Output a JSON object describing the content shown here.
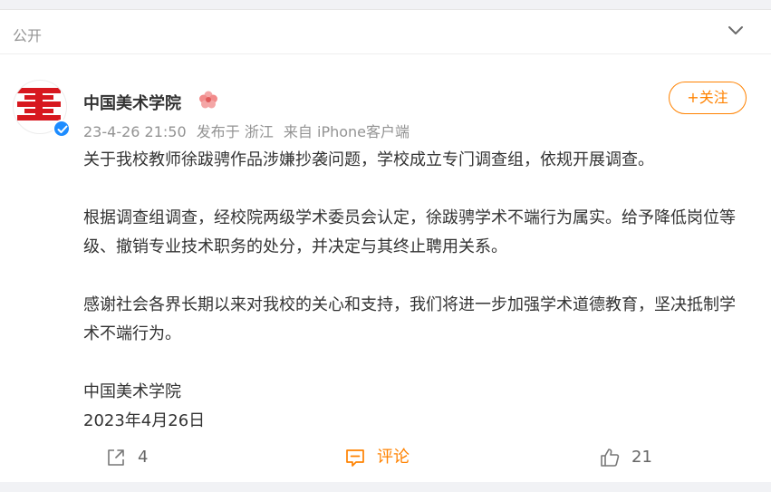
{
  "post": {
    "visibility": "公开",
    "author": "中国美术学院",
    "meta": {
      "time": "23-4-26 21:50",
      "location": "发布于 浙江",
      "source": "来自 iPhone客户端"
    },
    "follow_label": "+关注",
    "paragraphs": [
      "关于我校教师徐跋骋作品涉嫌抄袭问题，学校成立专门调查组，依规开展调查。",
      "根据调查组调查，经校院两级学术委员会认定，徐跋骋学术不端行为属实。给予降低岗位等级、撤销专业技术职务的处分，并决定与其终止聘用关系。",
      "感谢社会各界长期以来对我校的关心和支持，我们将进一步加强学术道德教育，坚决抵制学术不端行为。"
    ],
    "signature": "中国美术学院",
    "date": "2023年4月26日",
    "actions": {
      "share": "4",
      "comment": "评论",
      "like": "21"
    }
  },
  "colors": {
    "accent": "#ff8200",
    "logo_red": "#d7181f",
    "verified_blue": "#1d8cff"
  },
  "icons": [
    "chevron-down-icon",
    "verified-icon",
    "member-badge-icon",
    "share-icon",
    "comment-icon",
    "like-icon"
  ]
}
